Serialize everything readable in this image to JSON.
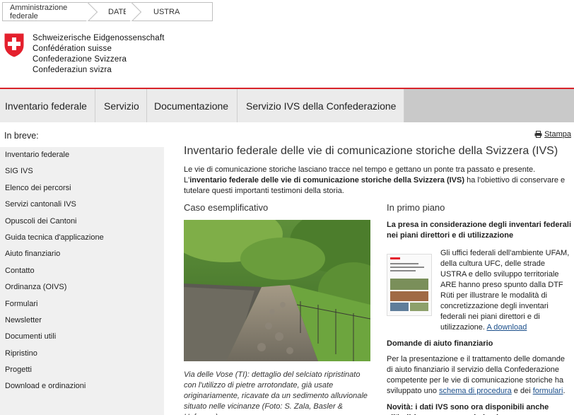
{
  "breadcrumb": [
    "Amministrazione federale",
    "DATEC",
    "USTRA"
  ],
  "logo": {
    "lines": [
      "Schweizerische Eidgenossenschaft",
      "Confédération suisse",
      "Confederazione Svizzera",
      "Confederaziun svizra"
    ],
    "colors": {
      "red": "#e4202d",
      "white": "#ffffff"
    }
  },
  "nav": [
    "Inventario federale",
    "Servizio",
    "Documentazione",
    "Servizio IVS della Confederazione"
  ],
  "sidebar": {
    "heading": "In breve:",
    "items": [
      "Inventario federale",
      "SIG IVS",
      "Elenco dei percorsi",
      "Servizi cantonali IVS",
      "Opuscoli dei Cantoni",
      "Guida tecnica d'applicazione",
      "Aiuto finanziario",
      "Contatto",
      "Ordinanza (OIVS)",
      "Formulari",
      "Newsletter",
      "Documenti utili",
      "Ripristino",
      "Progetti",
      "Download e ordinazioni"
    ]
  },
  "print_label": "Stampa",
  "main": {
    "title": "Inventario federale delle vie di comunicazione storiche della Svizzera (IVS)",
    "intro_plain": "Le vie di comunicazione storiche lasciano tracce nel tempo e gettano un ponte tra passato e presente. L'",
    "intro_bold": "inventario federale delle vie di comunicazione storiche della Svizzera (IVS)",
    "intro_end": " ha l'obiettivo di conservare e tutelare questi importanti testimoni della storia.",
    "example_heading": "Caso esemplificativo",
    "caption": "Via delle Vose (TI): dettaglio del selciato ripristinato con l'utilizzo di pietre arrotondate, già usate originariamente, ricavate da un sedimento alluvionale situato nelle vicinanze (Foto: S. Zala, Basler & Hofmann).",
    "focus_heading": "In primo piano",
    "news1_title": "La presa in considerazione degli inventari federali nei piani direttori e di utilizzazione",
    "news1_text": "Gli uffici federali dell'ambiente UFAM, della cultura UFC, delle strade USTRA e dello sviluppo territoriale ARE hanno preso spunto dalla DTF Rüti per illustrare le modalità di concretizzazione degli inventari federali nei piani direttori e di utilizzazione. ",
    "news1_link": "A download",
    "news2_title": "Domande di aiuto finanziario",
    "news2_text_a": "Per la presentazione e il trattamento delle domande di aiuto finanziario il servizio della Confederazione competente per le vie di comunicazione storiche ha sviluppato uno ",
    "news2_link1": "schema di procedura",
    "news2_text_b": " e dei ",
    "news2_link2": "formulari",
    "news2_text_c": ".",
    "news3_title": "Novità: i dati IVS sono ora disponibili anche all'indirizzo www.geo.admin.ch"
  }
}
